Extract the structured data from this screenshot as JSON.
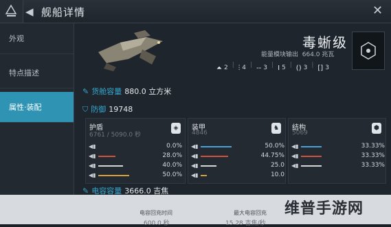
{
  "window": {
    "title": "舰船详情"
  },
  "sidebar": {
    "items": [
      {
        "label": "外观"
      },
      {
        "label": "特点描述"
      },
      {
        "label": "属性·装配",
        "active": true
      }
    ]
  },
  "ship": {
    "name": "毒蜥级",
    "power_label": "能量模块输出",
    "power_value": "664.0 兆瓦",
    "slots": [
      {
        "icon": "turret-icon",
        "value": "2"
      },
      {
        "icon": "missile-icon",
        "value": "4"
      },
      {
        "icon": "dash-icon",
        "value": "3"
      },
      {
        "icon": "bar-icon",
        "value": "5"
      },
      {
        "icon": "brace-icon",
        "value": "3"
      },
      {
        "icon": "bracket-icon",
        "value": "3"
      }
    ]
  },
  "stats": {
    "cargo": {
      "label": "货舱容量",
      "value": "880.0 立方米"
    },
    "defense": {
      "label": "防御",
      "value": "19748"
    },
    "capacitor": {
      "label": "电容容量",
      "value": "3666.0 吉焦"
    }
  },
  "panels": [
    {
      "name": "护盾",
      "value": "6761 / 5090.0 秒",
      "resists": [
        {
          "pct": "0.0%",
          "fill": 0.0,
          "color": "#4aa3d8"
        },
        {
          "pct": "28.0%",
          "fill": 0.28,
          "color": "#d0543e"
        },
        {
          "pct": "40.0%",
          "fill": 0.4,
          "color": "#d7d7d7"
        },
        {
          "pct": "50.0%",
          "fill": 0.5,
          "color": "#d9a13a"
        }
      ]
    },
    {
      "name": "装甲",
      "value": "4846",
      "resists": [
        {
          "pct": "50.0%",
          "fill": 0.5,
          "color": "#4aa3d8"
        },
        {
          "pct": "44.75%",
          "fill": 0.4475,
          "color": "#d0543e"
        },
        {
          "pct": "25.0",
          "fill": 0.25,
          "color": "#d7d7d7"
        },
        {
          "pct": "10.0",
          "fill": 0.1,
          "color": "#d9a13a"
        }
      ]
    },
    {
      "name": "结构",
      "value": "5069",
      "resists": [
        {
          "pct": "33.33%",
          "fill": 0.3333,
          "color": "#4aa3d8"
        },
        {
          "pct": "33.33%",
          "fill": 0.3333,
          "color": "#d0543e"
        },
        {
          "pct": "33.33%",
          "fill": 0.3333,
          "color": "#d7d7d7"
        }
      ]
    }
  ],
  "bottom": {
    "recharge_label": "电容回充时间",
    "recharge_value": "600.0 秒",
    "max_label": "最大电容回充",
    "max_value": "15.28 吉焦/秒"
  },
  "watermark": "维普手游网",
  "colors": {
    "accent": "#2f93b3",
    "label_blue": "#35a7cf"
  }
}
